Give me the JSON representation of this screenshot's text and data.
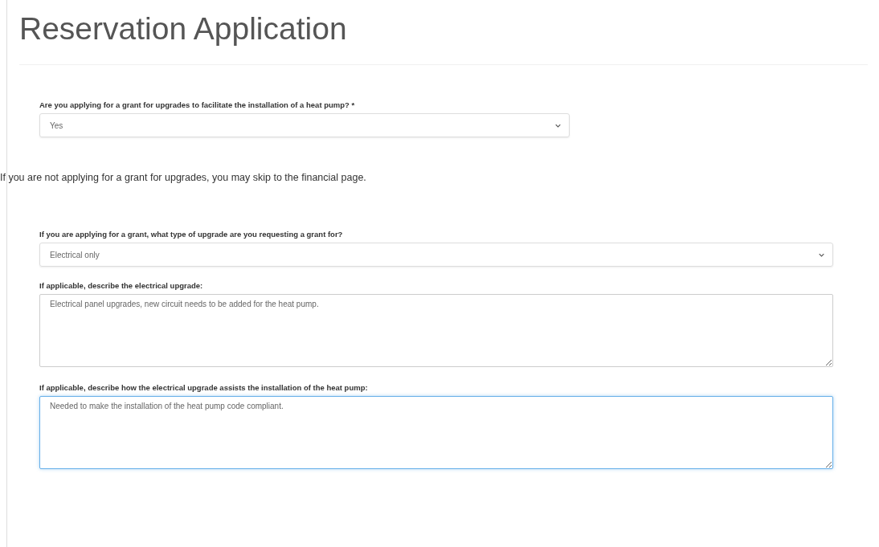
{
  "title": "Reservation Application",
  "sections": [
    {
      "kind": "short_select",
      "label": "Are you applying for a grant for upgrades to facilitate the installation of a heat pump? *",
      "value": "Yes"
    },
    {
      "kind": "note",
      "text": "If you are not applying for a grant for upgrades, you may skip to the financial page."
    },
    {
      "kind": "select",
      "label": "If you are applying for a grant, what type of upgrade are you requesting a grant for?",
      "value": "Electrical only"
    },
    {
      "kind": "textarea",
      "label": "If applicable, describe the electrical upgrade:",
      "value": "Electrical panel upgrades, new circuit needs to be added for the heat pump.",
      "focused": false
    },
    {
      "kind": "textarea",
      "label": "If applicable, describe how the electrical upgrade assists the installation of the heat pump:",
      "value": "Needed to make the installation of the heat pump code compliant.",
      "focused": true
    }
  ]
}
